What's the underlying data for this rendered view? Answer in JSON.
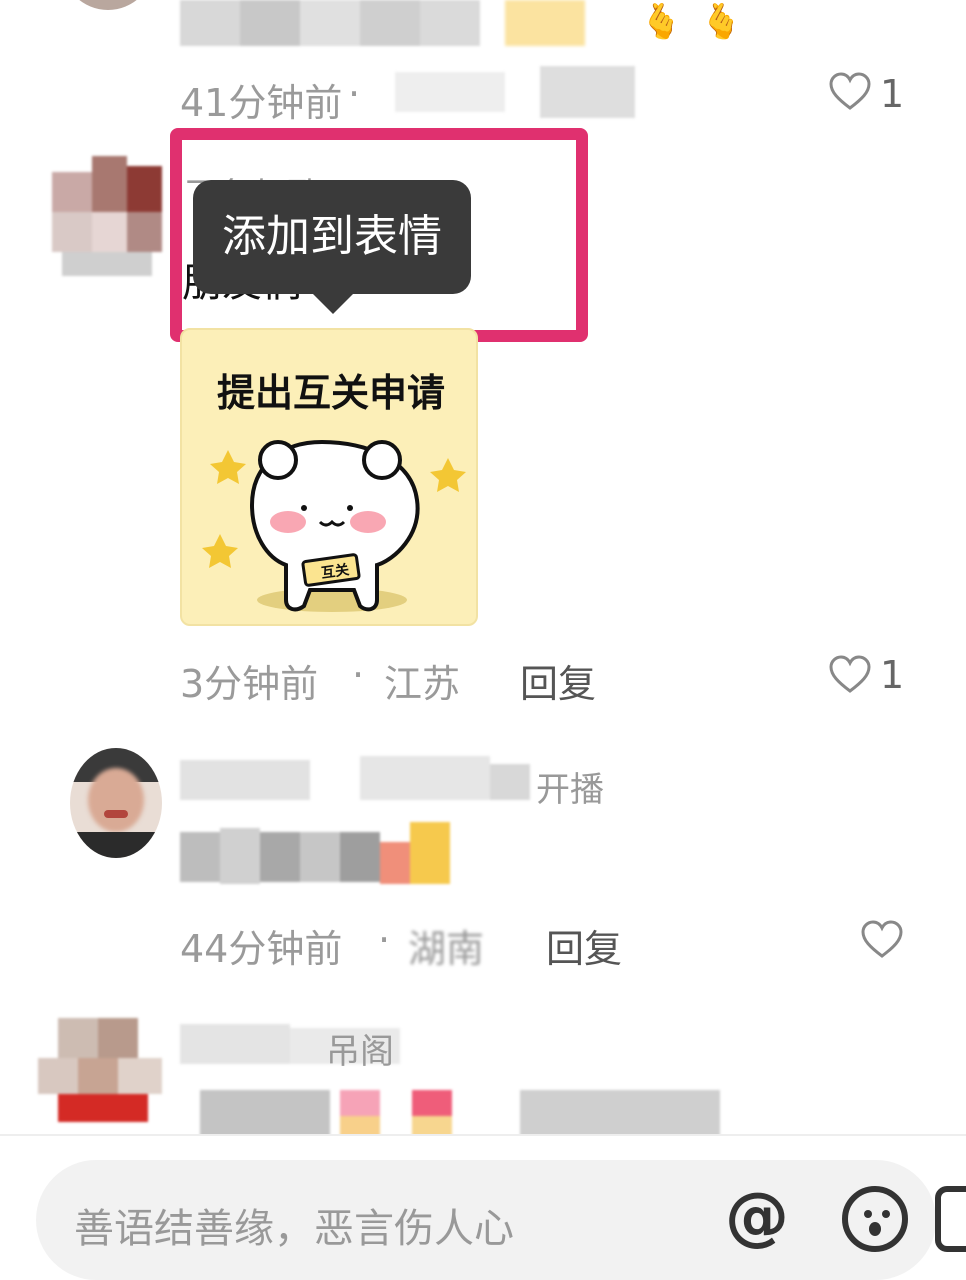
{
  "comments": [
    {
      "time": "41分钟前",
      "separator": "·",
      "likes": "1"
    },
    {
      "author": "飞象如歌",
      "text": "朋友们",
      "sticker_text": "提出互关申请",
      "sticker_badge": "互关",
      "time": "3分钟前",
      "separator": "·",
      "location": "江苏",
      "reply_label": "回复",
      "likes": "1"
    },
    {
      "author_suffix": "开播",
      "time": "44分钟前",
      "separator": "·",
      "location": "湖南",
      "reply_label": "回复"
    },
    {
      "author_suffix": "吊阁"
    }
  ],
  "context_menu": {
    "label": "添加到表情"
  },
  "input": {
    "placeholder": "善语结善缘，恶言伤人心",
    "at_label": "@"
  },
  "colors": {
    "highlight": "#e0306f",
    "tooltip_bg": "#3a3a3a",
    "sticker_bg": "#fcefb8"
  }
}
